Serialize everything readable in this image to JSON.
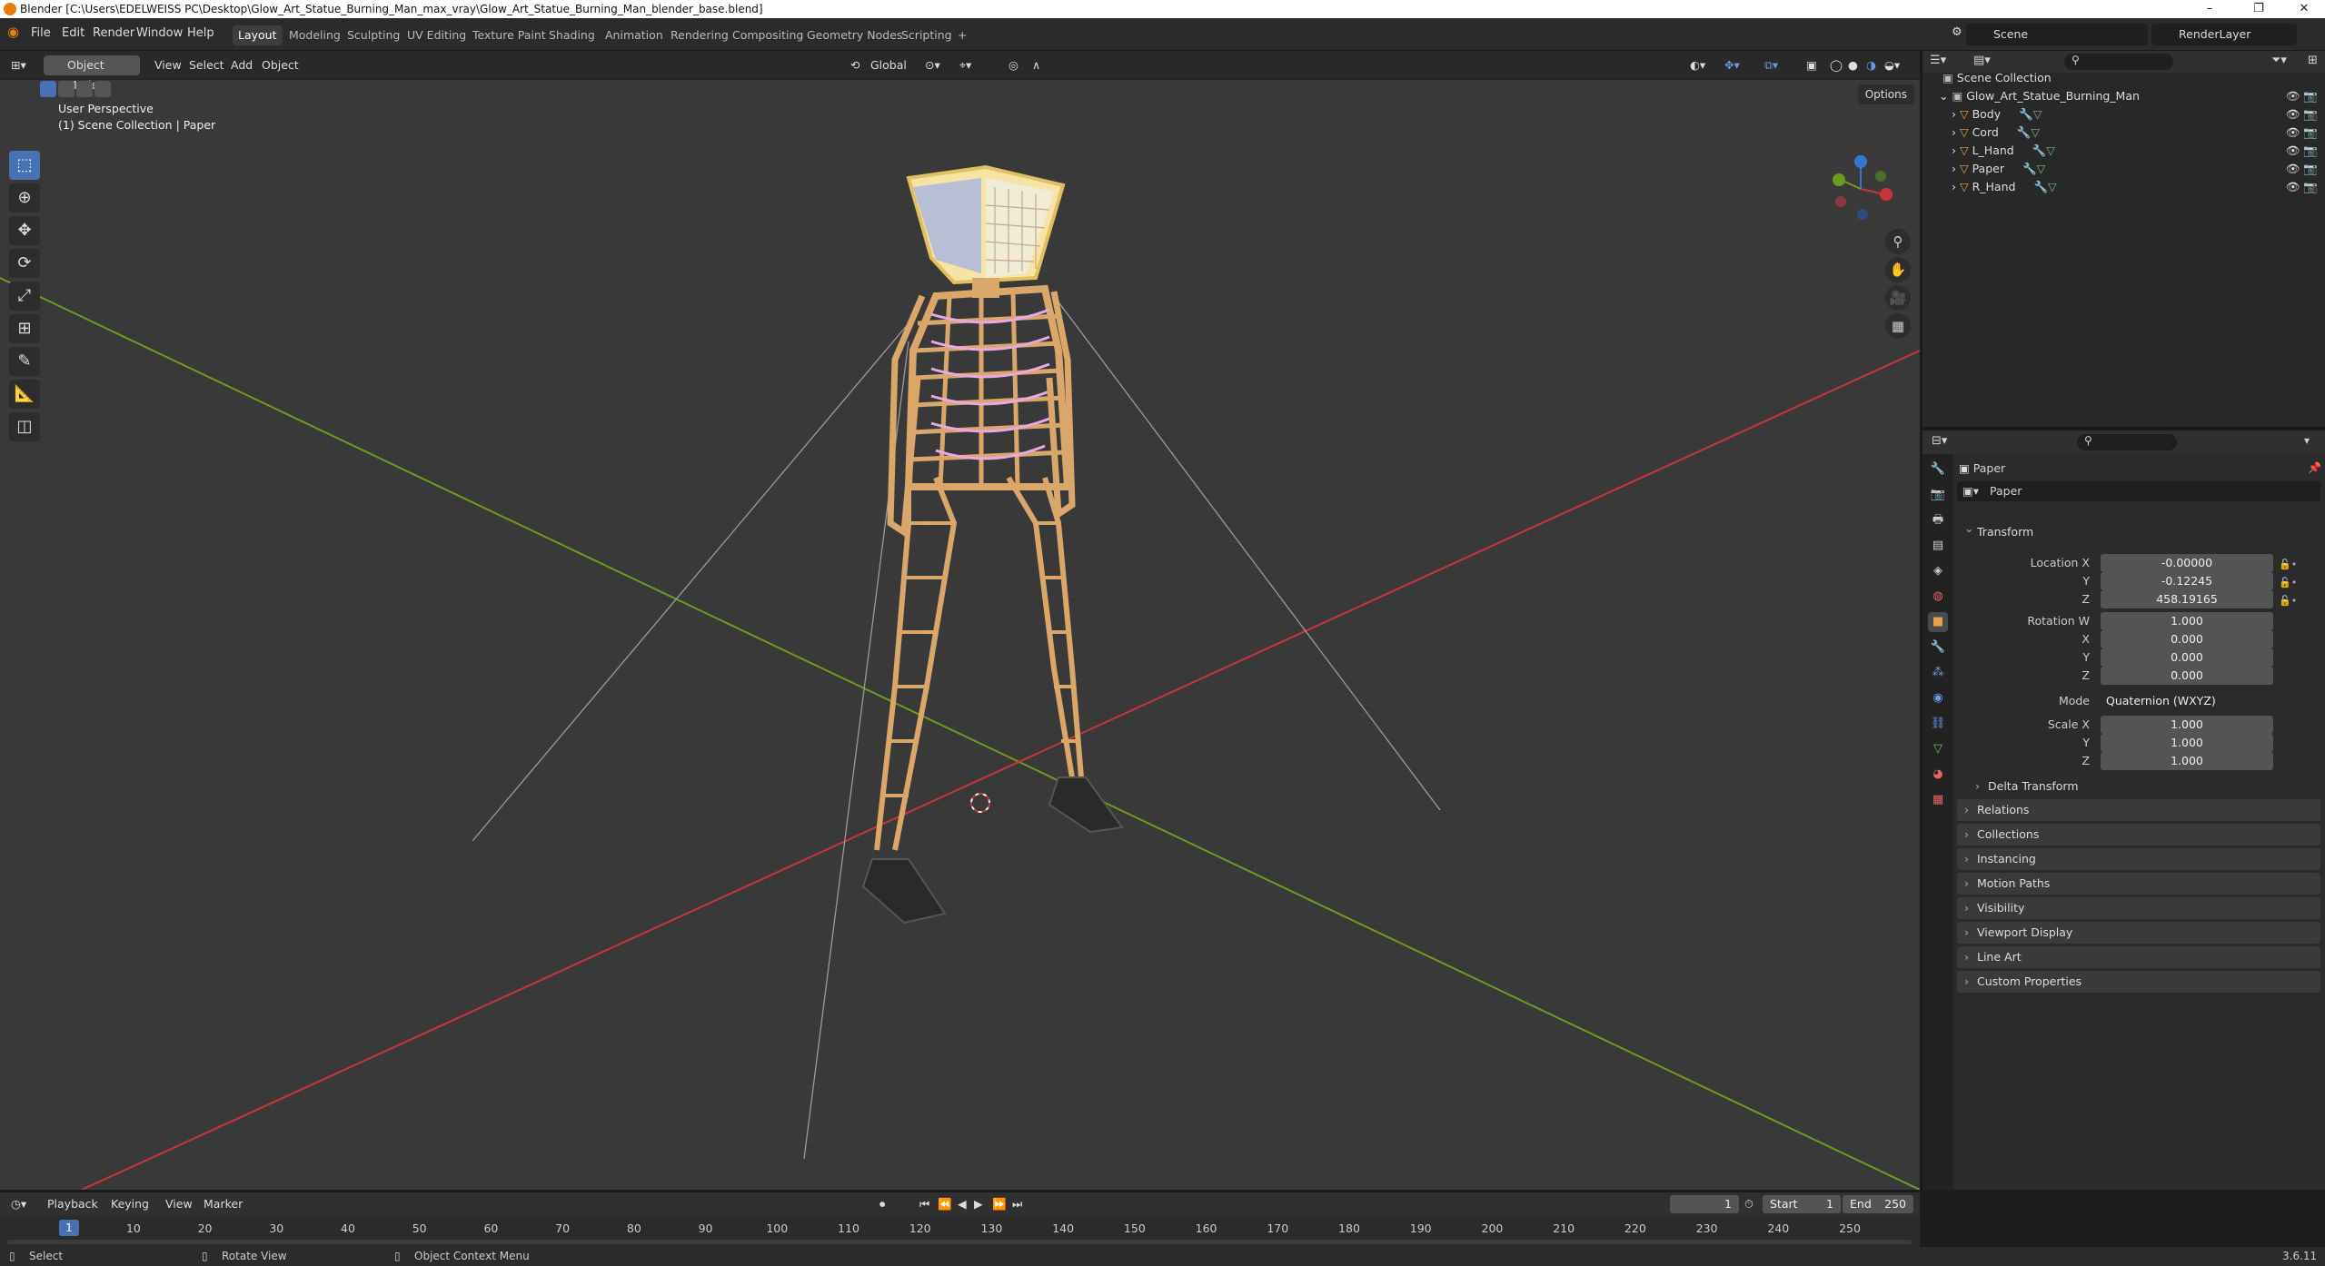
{
  "window": {
    "title": "Blender [C:\\Users\\EDELWEISS PC\\Desktop\\Glow_Art_Statue_Burning_Man_max_vray\\Glow_Art_Statue_Burning_Man_blender_base.blend]",
    "minimize": "–",
    "maximize": "❐",
    "close": "✕"
  },
  "menu": [
    "File",
    "Edit",
    "Render",
    "Window",
    "Help"
  ],
  "workspaces": [
    "Layout",
    "Modeling",
    "Sculpting",
    "UV Editing",
    "Texture Paint",
    "Shading",
    "Animation",
    "Rendering",
    "Compositing",
    "Geometry Nodes",
    "Scripting",
    "+"
  ],
  "active_workspace": "Layout",
  "scene": {
    "label": "Scene",
    "render_layer": "RenderLayer"
  },
  "viewport": {
    "mode": "Object Mode",
    "menus": [
      "View",
      "Select",
      "Add",
      "Object"
    ],
    "orientation": "Global",
    "options": "Options",
    "overlay_title": "User Perspective",
    "overlay_sub": "(1) Scene Collection | Paper"
  },
  "outliner": {
    "root": "Scene Collection",
    "collection": "Glow_Art_Statue_Burning_Man",
    "objects": [
      "Body",
      "Cord",
      "L_Hand",
      "Paper",
      "R_Hand"
    ],
    "selected": "Paper"
  },
  "properties": {
    "object_name": "Paper",
    "data_name": "Paper",
    "transform_label": "Transform",
    "location_label": "Location X",
    "location": [
      "-0.00000",
      "-0.12245",
      "458.19165"
    ],
    "rotation_label": "Rotation W",
    "rotation": [
      "1.000",
      "0.000",
      "0.000",
      "0.000"
    ],
    "mode_label": "Mode",
    "mode_value": "Quaternion (WXYZ)",
    "scale_label": "Scale X",
    "scale": [
      "1.000",
      "1.000",
      "1.000"
    ],
    "axis_labels": [
      "Y",
      "Z",
      "X"
    ],
    "delta": "Delta Transform",
    "panels": [
      "Relations",
      "Collections",
      "Instancing",
      "Motion Paths",
      "Visibility",
      "Viewport Display",
      "Line Art",
      "Custom Properties"
    ]
  },
  "timeline": {
    "menus": [
      "Playback",
      "Keying",
      "View",
      "Marker"
    ],
    "current_frame": "1",
    "start_label": "Start",
    "start": "1",
    "end_label": "End",
    "end": "250",
    "ticks": [
      "1",
      "10",
      "20",
      "30",
      "40",
      "50",
      "60",
      "70",
      "80",
      "90",
      "100",
      "110",
      "120",
      "130",
      "140",
      "150",
      "160",
      "170",
      "180",
      "190",
      "200",
      "210",
      "220",
      "230",
      "240",
      "250"
    ]
  },
  "status": {
    "select": "Select",
    "rotate": "Rotate View",
    "context": "Object Context Menu",
    "version": "3.6.11"
  },
  "colors": {
    "accent": "#4772b3",
    "x_axis": "#c8343a",
    "y_axis": "#6e9a1e",
    "z_axis": "#3a74d1",
    "wood": "#d9a76a",
    "glow": "#e9a7e6"
  }
}
